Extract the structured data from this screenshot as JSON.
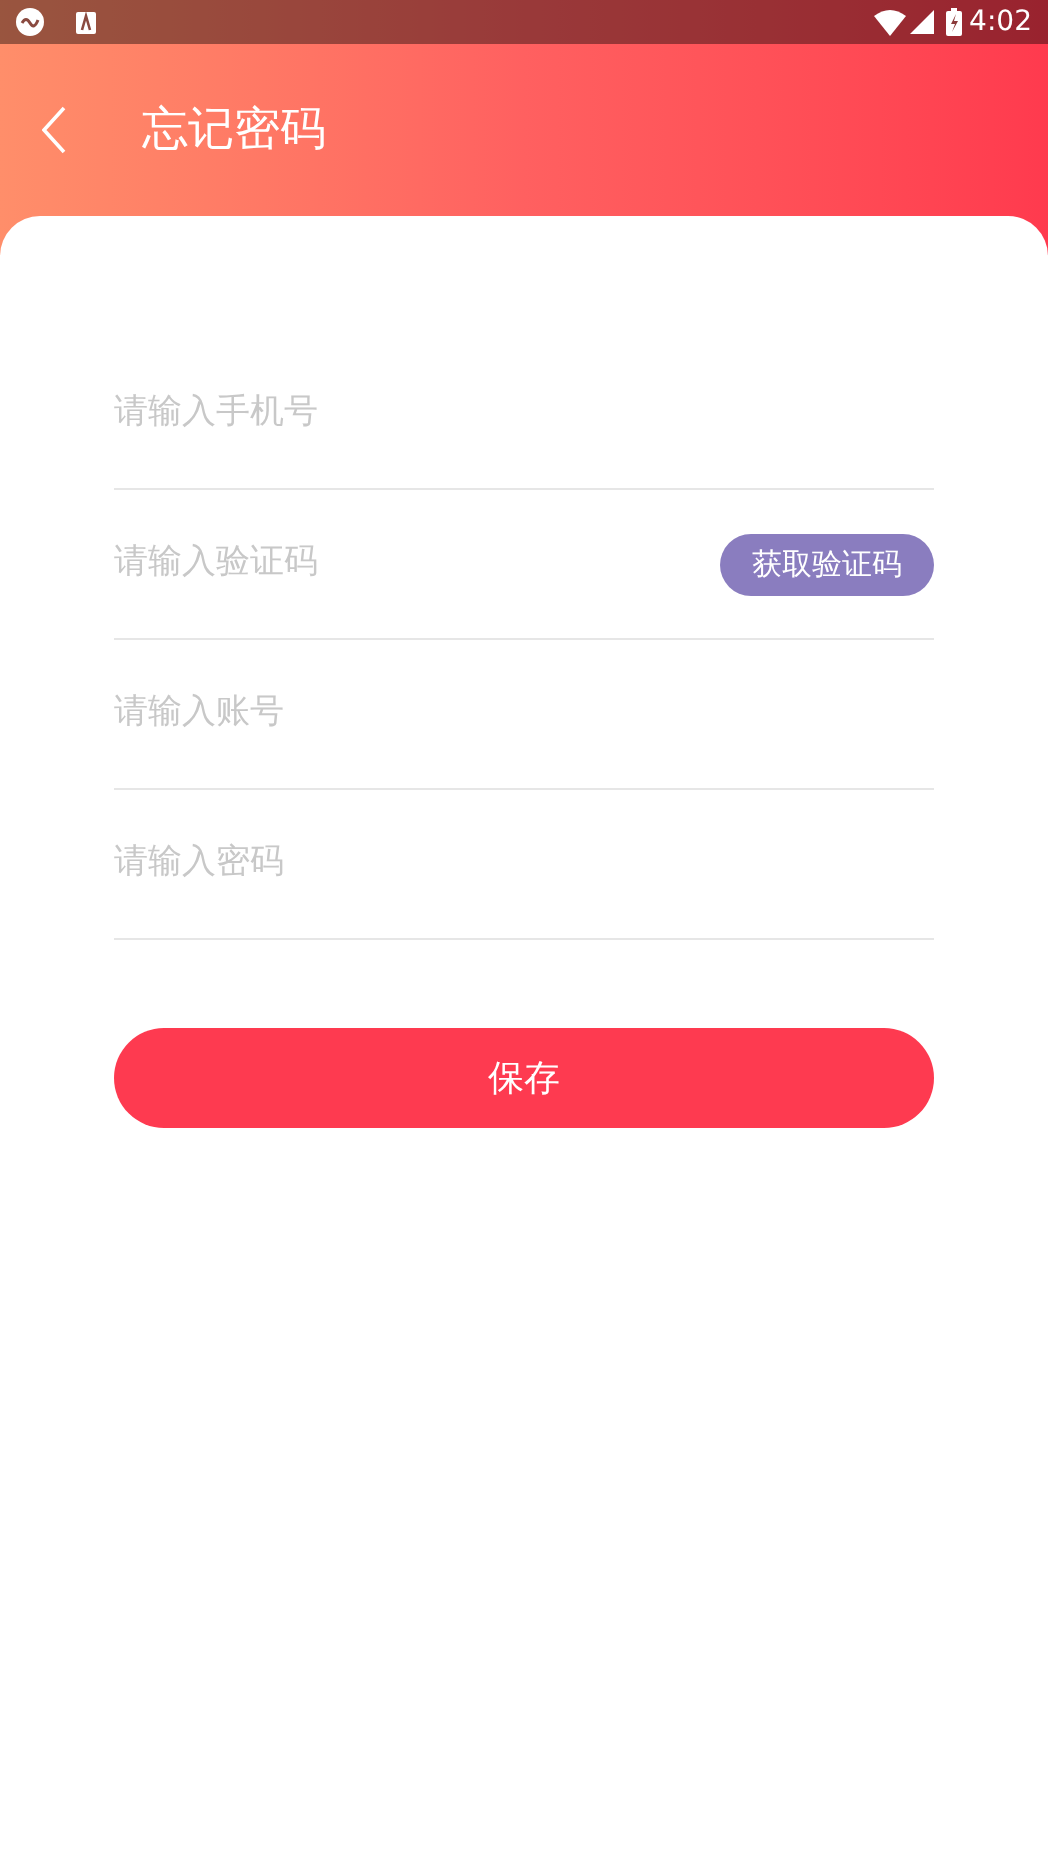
{
  "status_bar": {
    "time": "4:02"
  },
  "header": {
    "title": "忘记密码"
  },
  "fields": [
    {
      "kind": "plain",
      "placeholder": "请输入手机号"
    },
    {
      "kind": "code",
      "placeholder": "请输入验证码",
      "button": "获取验证码"
    },
    {
      "kind": "plain",
      "placeholder": "请输入账号"
    },
    {
      "kind": "plain",
      "placeholder": "请输入密码"
    }
  ],
  "submit": "保存"
}
